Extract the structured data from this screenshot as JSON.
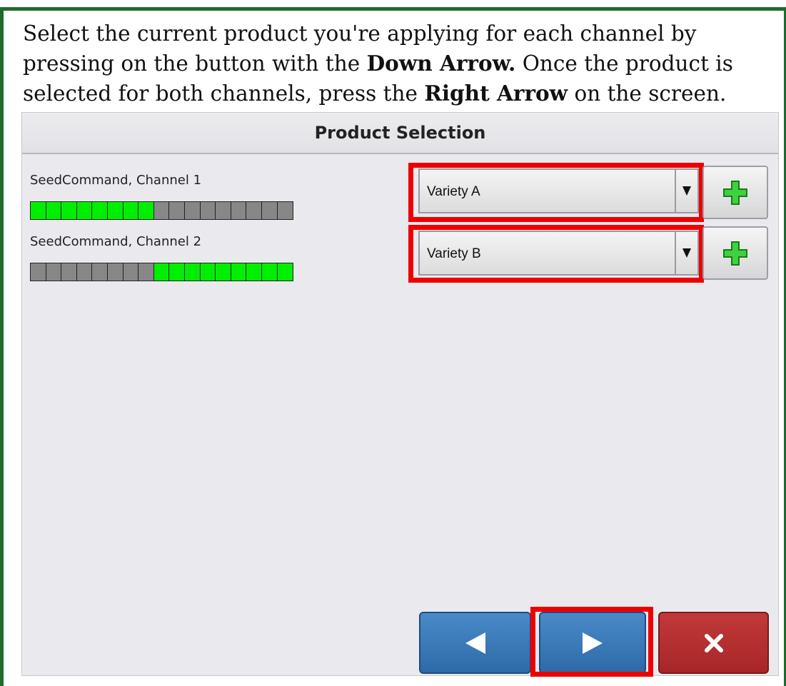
{
  "instructions": {
    "part1": "Select the current product you're applying for each channel by pressing on the button with the ",
    "bold1": "Down Arrow.",
    "part2": " Once the product is selected for both channels, press the ",
    "bold2": "Right Arrow",
    "part3": " on the screen."
  },
  "screen": {
    "title": "Product Selection",
    "channels": [
      {
        "label": "SeedCommand, Channel 1",
        "product": "Variety A",
        "segments": [
          1,
          1,
          1,
          1,
          1,
          1,
          1,
          1,
          0,
          0,
          0,
          0,
          0,
          0,
          0,
          0,
          0
        ]
      },
      {
        "label": "SeedCommand, Channel 2",
        "product": "Variety B",
        "segments": [
          0,
          0,
          0,
          0,
          0,
          0,
          0,
          0,
          1,
          1,
          1,
          1,
          1,
          1,
          1,
          1,
          1
        ]
      }
    ],
    "icons": {
      "dropdown": "down-triangle-icon",
      "add": "green-plus-icon",
      "back": "left-arrow-icon",
      "next": "right-arrow-icon",
      "cancel": "close-x-icon"
    }
  },
  "colors": {
    "highlight": "#ee0000",
    "segment_on": "#00ee00",
    "segment_off": "#878787",
    "nav_blue": "#3a7ab8",
    "cancel_red": "#b42f30",
    "frame_green": "#1f6b2c"
  }
}
